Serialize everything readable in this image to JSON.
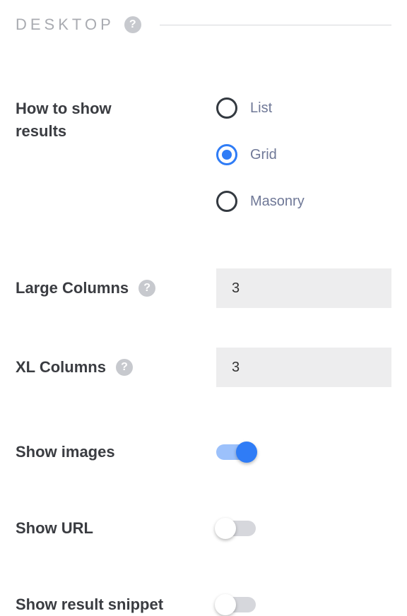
{
  "section": {
    "title": "DESKTOP"
  },
  "fields": {
    "showResults": {
      "label": "How to show results",
      "options": {
        "list": "List",
        "grid": "Grid",
        "masonry": "Masonry"
      },
      "value": "grid"
    },
    "largeColumns": {
      "label": "Large Columns",
      "value": "3"
    },
    "xlColumns": {
      "label": "XL Columns",
      "value": "3"
    },
    "showImages": {
      "label": "Show images",
      "value": true
    },
    "showUrl": {
      "label": "Show URL",
      "value": false
    },
    "showSnippet": {
      "label": "Show result snippet",
      "value": false
    }
  }
}
